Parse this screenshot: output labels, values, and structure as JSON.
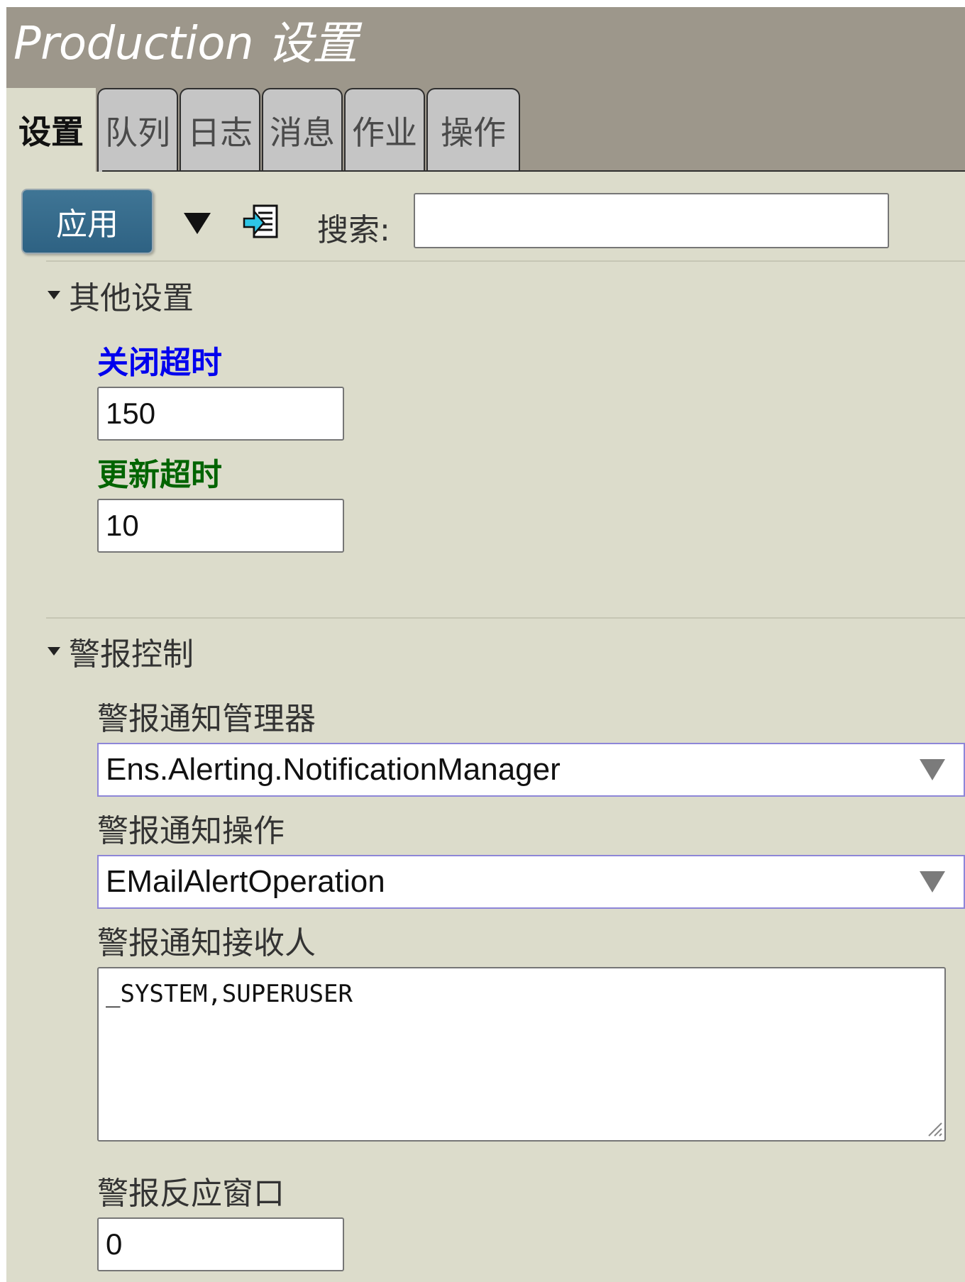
{
  "header": {
    "title": "Production 设置"
  },
  "tabs": [
    {
      "label": "设置",
      "active": true
    },
    {
      "label": "队列",
      "active": false
    },
    {
      "label": "日志",
      "active": false
    },
    {
      "label": "消息",
      "active": false
    },
    {
      "label": "作业",
      "active": false
    },
    {
      "label": "操作",
      "active": false
    }
  ],
  "toolbar": {
    "apply_label": "应用",
    "menu_icon": "down-triangle-icon",
    "export_icon": "export-document-icon",
    "search_label": "搜索:",
    "search_value": ""
  },
  "sections": {
    "other": {
      "title": "其他设置",
      "shutdown_timeout": {
        "label": "关闭超时",
        "value": "150",
        "label_color": "#0000ee"
      },
      "update_timeout": {
        "label": "更新超时",
        "value": "10",
        "label_color": "#006400"
      }
    },
    "alert": {
      "title": "警报控制",
      "notification_manager": {
        "label": "警报通知管理器",
        "value": "Ens.Alerting.NotificationManager"
      },
      "notification_operation": {
        "label": "警报通知操作",
        "value": "EMailAlertOperation"
      },
      "notification_recipients": {
        "label": "警报通知接收人",
        "value": "_SYSTEM,SUPERUSER"
      },
      "action_window": {
        "label": "警报反应窗口",
        "value": "0"
      }
    }
  },
  "colors": {
    "header_bg": "#9d978b",
    "panel_bg": "#dcdccb",
    "apply_button": "#2e6283"
  }
}
